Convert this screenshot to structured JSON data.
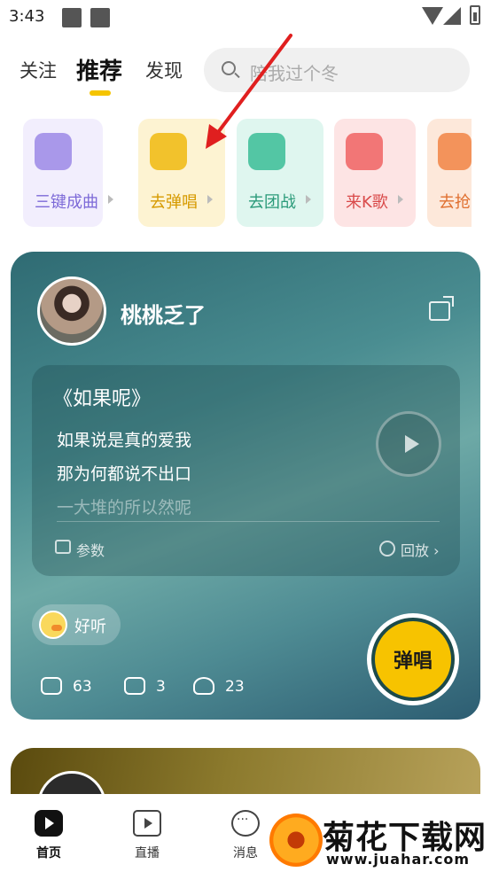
{
  "status_bar": {
    "time": "3:43"
  },
  "top_nav": {
    "tabs": [
      {
        "label": "关注",
        "active": false
      },
      {
        "label": "推荐",
        "active": true
      },
      {
        "label": "发现",
        "active": false
      }
    ],
    "search": {
      "placeholder": "陪我过个冬"
    }
  },
  "shortcuts": [
    {
      "label": "三键成曲",
      "bg": "#f2eefd",
      "icon_bg": "#a998ea",
      "color": "#7d6ad8",
      "icon": "sliders-icon"
    },
    {
      "label": "去弹唱",
      "bg": "#fdf3d2",
      "icon_bg": "#f2c22c",
      "color": "#d69a00",
      "icon": "piano-icon"
    },
    {
      "label": "去团战",
      "bg": "#dff6ef",
      "icon_bg": "#53c6a4",
      "color": "#2b9b7a",
      "icon": "trophy-icon"
    },
    {
      "label": "来K歌",
      "bg": "#fde4e4",
      "icon_bg": "#f27676",
      "color": "#d94a4a",
      "icon": "music-house-icon"
    },
    {
      "label": "去抢",
      "bg": "#fde8da",
      "icon_bg": "#f3935b",
      "color": "#e07030",
      "icon": "grab-icon"
    }
  ],
  "post": {
    "username": "桃桃乏了",
    "song_title": "《如果呢》",
    "lyrics": [
      "如果说是真的爱我",
      "那为何都说不出口",
      "一大堆的所以然呢"
    ],
    "params_label": "参数",
    "replay_label": "回放 ›",
    "tag_label": "好听",
    "stats": {
      "likes": "63",
      "comments": "3",
      "gifts": "23"
    },
    "sing_button": "弹唱"
  },
  "bottom_nav": [
    {
      "label": "首页",
      "icon": "home-play-icon",
      "active": true
    },
    {
      "label": "直播",
      "icon": "live-tv-icon",
      "active": false
    },
    {
      "label": "消息",
      "icon": "message-bubble-icon",
      "active": false
    }
  ],
  "watermark": {
    "title": "菊花下载网",
    "url": "www.juahar.com"
  }
}
